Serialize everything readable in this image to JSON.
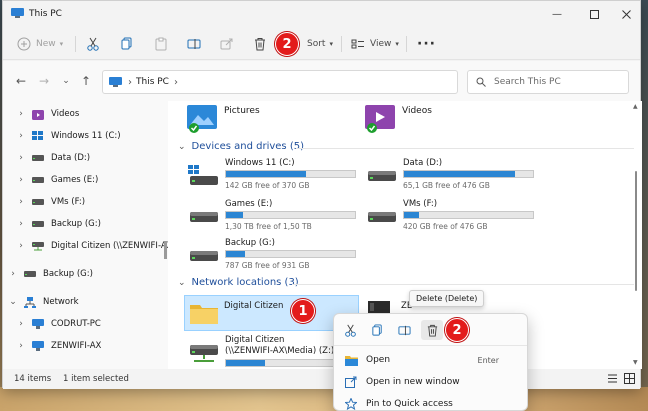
{
  "window": {
    "title": "This PC"
  },
  "colors": {
    "accent": "#2c86d3",
    "badge": "#e31b1b",
    "selection": "#cce8ff",
    "section": "#1e4e9a"
  },
  "commandbar": {
    "new_label": "New",
    "sort_label": "Sort",
    "view_label": "View",
    "icons": [
      "cut-icon",
      "copy-icon",
      "paste-icon",
      "rename-icon",
      "share-icon",
      "delete-icon",
      "more-icon"
    ]
  },
  "badges": {
    "one": "1",
    "two": "2"
  },
  "address": {
    "crumb": "This PC"
  },
  "search": {
    "placeholder": "Search This PC"
  },
  "sidebar": {
    "items": [
      {
        "label": "Videos"
      },
      {
        "label": "Windows 11 (C:)"
      },
      {
        "label": "Data (D:)"
      },
      {
        "label": "Games (E:)"
      },
      {
        "label": "VMs (F:)"
      },
      {
        "label": "Backup (G:)"
      },
      {
        "label": "Digital Citizen (\\\\ZENWIFI-AX\\M"
      },
      {
        "label": "Backup (G:)"
      },
      {
        "label": "Network"
      },
      {
        "label": "CODRUT-PC"
      },
      {
        "label": "ZENWIFI-AX"
      }
    ]
  },
  "folders": [
    {
      "label": "Pictures"
    },
    {
      "label": "Videos"
    }
  ],
  "sections": {
    "devices": "Devices and drives (5)",
    "network": "Network locations (3)"
  },
  "drives": [
    {
      "name": "Windows 11 (C:)",
      "free": "142 GB free of 370 GB",
      "used_fraction": 0.62
    },
    {
      "name": "Data (D:)",
      "free": "65,1 GB free of 476 GB",
      "used_fraction": 0.86
    },
    {
      "name": "Games (E:)",
      "free": "1,30 TB free of 1,50 TB",
      "used_fraction": 0.13
    },
    {
      "name": "VMs (F:)",
      "free": "420 GB free of 476 GB",
      "used_fraction": 0.12
    },
    {
      "name": "Backup (G:)",
      "free": "787 GB free of 931 GB",
      "used_fraction": 0.15
    }
  ],
  "network_items": [
    {
      "label": "Digital Citizen"
    },
    {
      "label": "ZE"
    },
    {
      "name": "Digital Citizen",
      "path": "(\\\\ZENWIFI-AX\\Media) (Z:)",
      "used_fraction": 0.3
    }
  ],
  "status": {
    "count": "14 items",
    "selected": "1 item selected"
  },
  "tooltip": "Delete (Delete)",
  "context_menu": {
    "items": [
      {
        "label": "Open",
        "shortcut": "Enter"
      },
      {
        "label": "Open in new window",
        "shortcut": ""
      },
      {
        "label": "Pin to Quick access",
        "shortcut": ""
      }
    ]
  }
}
